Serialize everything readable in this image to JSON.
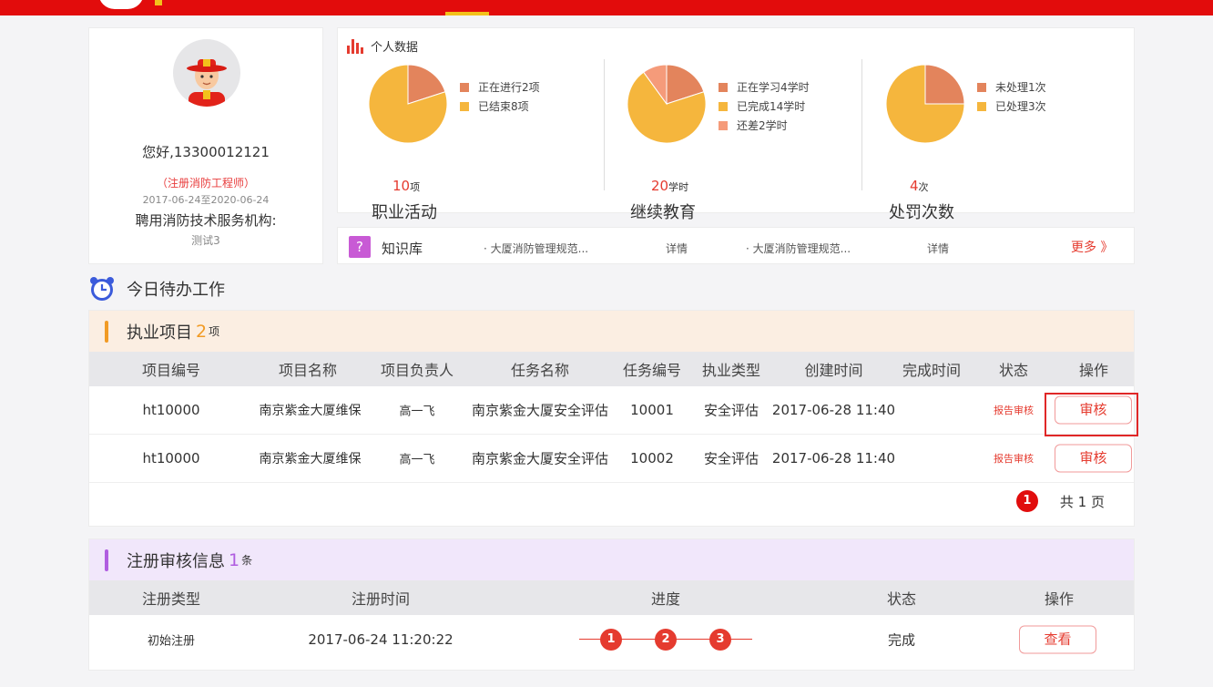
{
  "profile": {
    "greeting": "您好,13300012121",
    "role": "（注册消防工程师）",
    "dates": "2017-06-24至2020-06-24",
    "org": "聘用消防技术服务机构:",
    "org_value": "测试3"
  },
  "stats": {
    "title": "个人数据",
    "items": [
      {
        "count": "10",
        "unit": "项",
        "name": "职业活动",
        "legend": [
          "正在进行2项",
          "已结束8项"
        ],
        "colors": [
          "#e3845c",
          "#f5b63d"
        ],
        "values": [
          2,
          8
        ]
      },
      {
        "count": "20",
        "unit": "学时",
        "name": "继续教育",
        "legend": [
          "正在学习4学时",
          "已完成14学时",
          "还差2学时"
        ],
        "colors": [
          "#e3845c",
          "#f5b63d",
          "#f59b7a"
        ],
        "values": [
          4,
          14,
          2
        ]
      },
      {
        "count": "4",
        "unit": "次",
        "name": "处罚次数",
        "legend": [
          "未处理1次",
          "已处理3次"
        ],
        "colors": [
          "#e3845c",
          "#f5b63d"
        ],
        "values": [
          1,
          3
        ]
      }
    ]
  },
  "kb": {
    "icon": "?",
    "title": "知识库",
    "items": [
      "· 大厦消防管理规范...",
      "详情",
      "· 大厦消防管理规范...",
      "详情"
    ],
    "more": "更多 》"
  },
  "todo": {
    "title": "今日待办工作",
    "projects": {
      "title": "执业项目",
      "count": "2",
      "unit": "项",
      "headers": [
        "项目编号",
        "项目名称",
        "项目负责人",
        "任务名称",
        "任务编号",
        "执业类型",
        "创建时间",
        "完成时间",
        "状态",
        "操作"
      ],
      "rows": [
        {
          "no": "ht10000",
          "name": "南京紫金大厦维保",
          "owner": "高一飞",
          "task": "南京紫金大厦安全评估",
          "task_no": "10001",
          "type": "安全评估",
          "created": "2017-06-28 11:40",
          "done": "",
          "status": "报告审核",
          "action": "审核"
        },
        {
          "no": "ht10000",
          "name": "南京紫金大厦维保",
          "owner": "高一飞",
          "task": "南京紫金大厦安全评估",
          "task_no": "10002",
          "type": "安全评估",
          "created": "2017-06-28 11:40",
          "done": "",
          "status": "报告审核",
          "action": "审核"
        }
      ],
      "pager": {
        "page": "1",
        "total_label": "共 1 页"
      }
    },
    "registration": {
      "title": "注册审核信息",
      "count": "1",
      "unit": "条",
      "headers": [
        "注册类型",
        "注册时间",
        "进度",
        "状态",
        "操作"
      ],
      "rows": [
        {
          "type": "初始注册",
          "time": "2017-06-24 11:20:22",
          "steps": [
            "1",
            "2",
            "3"
          ],
          "status": "完成",
          "action": "查看"
        }
      ]
    }
  },
  "colors": {
    "brand_red": "#e20c0c",
    "accent_yellow": "#f3c11b",
    "orange_band": "#fbeee2",
    "purple_band": "#f1e7fb"
  }
}
